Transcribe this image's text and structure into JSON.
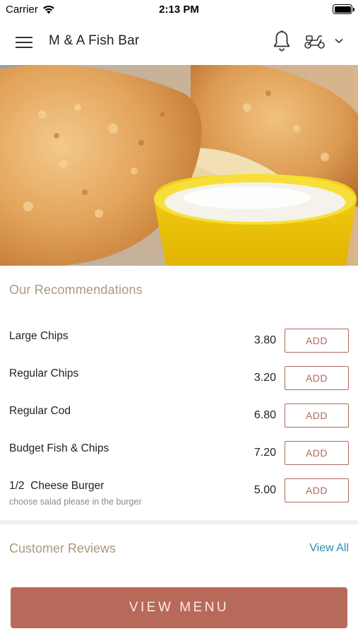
{
  "status_bar": {
    "carrier": "Carrier",
    "time": "2:13 PM"
  },
  "header": {
    "title": "M & A Fish Bar",
    "icons": [
      "menu-icon",
      "bell-icon",
      "scooter-icon",
      "chevron-down-icon"
    ]
  },
  "hero": {
    "image": "fish-and-chips-photo"
  },
  "recommendations": {
    "title": "Our Recommendations",
    "add_label": "ADD",
    "items": [
      {
        "name": "Large Chips",
        "price": "3.80",
        "note": ""
      },
      {
        "name": "Regular Chips",
        "price": "3.20",
        "note": ""
      },
      {
        "name": "Regular Cod",
        "price": "6.80",
        "note": ""
      },
      {
        "name": "Budget Fish & Chips",
        "price": "7.20",
        "note": ""
      },
      {
        "name": "1/2  Cheese Burger",
        "price": "5.00",
        "note": "choose salad please in the burger"
      }
    ]
  },
  "reviews": {
    "title": "Customer Reviews",
    "view_all": "View All"
  },
  "footer": {
    "view_menu": "VIEW MENU"
  },
  "colors": {
    "accent": "#b86a5a",
    "section_title": "#a99a7c",
    "link": "#2a8fb0"
  }
}
